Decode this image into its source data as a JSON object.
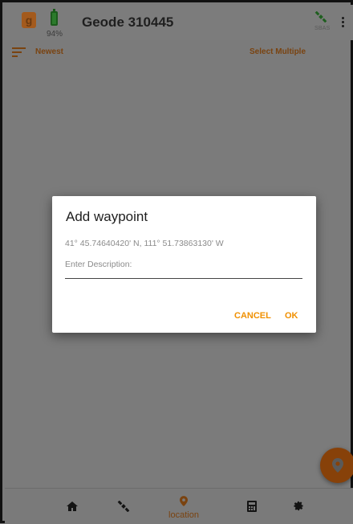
{
  "appbar": {
    "logo_letter": "g",
    "battery_percent": "94%",
    "device_title": "Geode 310445",
    "sat_status_label": "SBAS",
    "more_icon": "more-vert-icon"
  },
  "sortbar": {
    "sort_label": "Newest",
    "select_multiple_label": "Select Multiple"
  },
  "dialog": {
    "title": "Add waypoint",
    "coordinates": "41° 45.74640420' N, 111° 51.73863130' W",
    "description_placeholder": "Enter Description:",
    "description_value": "",
    "cancel_label": "CANCEL",
    "ok_label": "OK"
  },
  "bottomnav": {
    "items": [
      {
        "icon": "home-icon"
      },
      {
        "icon": "satellite-icon"
      },
      {
        "icon": "location-pin-icon",
        "label": "location"
      },
      {
        "icon": "calculator-icon"
      },
      {
        "icon": "gear-icon"
      }
    ]
  },
  "colors": {
    "accent": "#f09000",
    "accent_dimmed": "#7a4310",
    "fab": "#874109",
    "scrim": "#7b7b7b"
  }
}
